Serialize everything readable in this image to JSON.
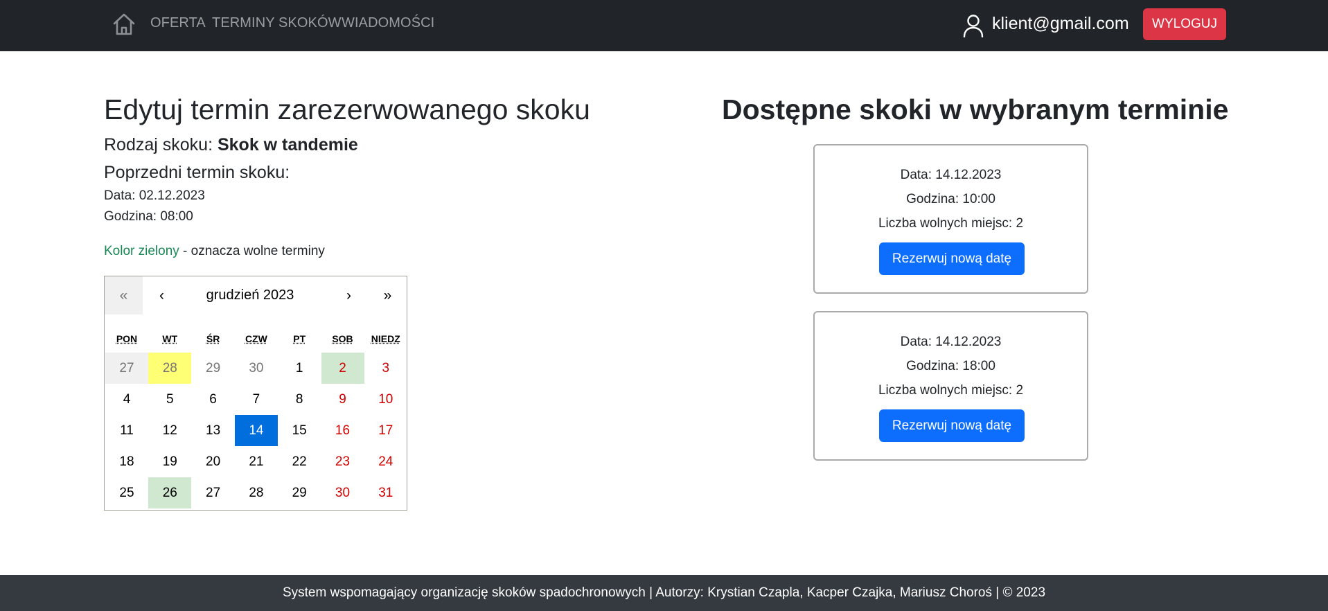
{
  "nav": {
    "links": [
      "OFERTA",
      "TERMINY SKOKÓW",
      "WIADOMOŚCI"
    ],
    "user_email": "klient@gmail.com",
    "logout_label": "WYLOGUJ"
  },
  "left": {
    "title": "Edytuj termin zarezerwowanego skoku",
    "jump_type_label": "Rodzaj skoku: ",
    "jump_type_value": "Skok w tandemie",
    "previous_title": "Poprzedni termin skoku:",
    "previous_date": "Data: 02.12.2023",
    "previous_hour": "Godzina: 08:00",
    "legend_colored": "Kolor zielony",
    "legend_rest": " - oznacza wolne terminy"
  },
  "calendar": {
    "nav_prev_year": "«",
    "nav_prev_month": "‹",
    "month_label": "grudzień 2023",
    "nav_next_month": "›",
    "nav_next_year": "»",
    "weekdays": [
      "PON",
      "WT",
      "ŚR",
      "CZW",
      "PT",
      "SOB",
      "NIEDZ"
    ],
    "weeks": [
      [
        {
          "d": "27",
          "neighbor": true,
          "state": "grey"
        },
        {
          "d": "28",
          "neighbor": true,
          "state": "today"
        },
        {
          "d": "29",
          "neighbor": true,
          "state": ""
        },
        {
          "d": "30",
          "neighbor": true,
          "state": ""
        },
        {
          "d": "1",
          "neighbor": false,
          "state": ""
        },
        {
          "d": "2",
          "neighbor": false,
          "state": "free"
        },
        {
          "d": "3",
          "neighbor": false,
          "state": ""
        }
      ],
      [
        {
          "d": "4",
          "neighbor": false,
          "state": ""
        },
        {
          "d": "5",
          "neighbor": false,
          "state": ""
        },
        {
          "d": "6",
          "neighbor": false,
          "state": ""
        },
        {
          "d": "7",
          "neighbor": false,
          "state": ""
        },
        {
          "d": "8",
          "neighbor": false,
          "state": ""
        },
        {
          "d": "9",
          "neighbor": false,
          "state": ""
        },
        {
          "d": "10",
          "neighbor": false,
          "state": ""
        }
      ],
      [
        {
          "d": "11",
          "neighbor": false,
          "state": ""
        },
        {
          "d": "12",
          "neighbor": false,
          "state": ""
        },
        {
          "d": "13",
          "neighbor": false,
          "state": ""
        },
        {
          "d": "14",
          "neighbor": false,
          "state": "selected"
        },
        {
          "d": "15",
          "neighbor": false,
          "state": ""
        },
        {
          "d": "16",
          "neighbor": false,
          "state": ""
        },
        {
          "d": "17",
          "neighbor": false,
          "state": ""
        }
      ],
      [
        {
          "d": "18",
          "neighbor": false,
          "state": ""
        },
        {
          "d": "19",
          "neighbor": false,
          "state": ""
        },
        {
          "d": "20",
          "neighbor": false,
          "state": ""
        },
        {
          "d": "21",
          "neighbor": false,
          "state": ""
        },
        {
          "d": "22",
          "neighbor": false,
          "state": ""
        },
        {
          "d": "23",
          "neighbor": false,
          "state": ""
        },
        {
          "d": "24",
          "neighbor": false,
          "state": ""
        }
      ],
      [
        {
          "d": "25",
          "neighbor": false,
          "state": ""
        },
        {
          "d": "26",
          "neighbor": false,
          "state": "free"
        },
        {
          "d": "27",
          "neighbor": false,
          "state": ""
        },
        {
          "d": "28",
          "neighbor": false,
          "state": ""
        },
        {
          "d": "29",
          "neighbor": false,
          "state": ""
        },
        {
          "d": "30",
          "neighbor": false,
          "state": ""
        },
        {
          "d": "31",
          "neighbor": false,
          "state": ""
        }
      ]
    ]
  },
  "right": {
    "title": "Dostępne skoki w wybranym terminie",
    "slots": [
      {
        "date": "Data: 14.12.2023",
        "hour": "Godzina: 10:00",
        "free": "Liczba wolnych miejsc: 2",
        "button": "Rezerwuj nową datę"
      },
      {
        "date": "Data: 14.12.2023",
        "hour": "Godzina: 18:00",
        "free": "Liczba wolnych miejsc: 2",
        "button": "Rezerwuj nową datę"
      }
    ]
  },
  "footer": {
    "text": "System wspomagający organizację skoków spadochronowych | Autorzy: Krystian Czapla, Kacper Czajka, Mariusz Choroś | © 2023"
  },
  "colors": {
    "navbar": "#212529",
    "logout": "#dc3545",
    "primary": "#0d6efd",
    "free_day": "#cfe8cf",
    "today": "#ffff76",
    "selected_day": "#006edc",
    "weekend_text": "#d10000",
    "legend_green": "#198754",
    "footer": "#343a40"
  },
  "icons": [
    "home-icon",
    "user-icon"
  ]
}
